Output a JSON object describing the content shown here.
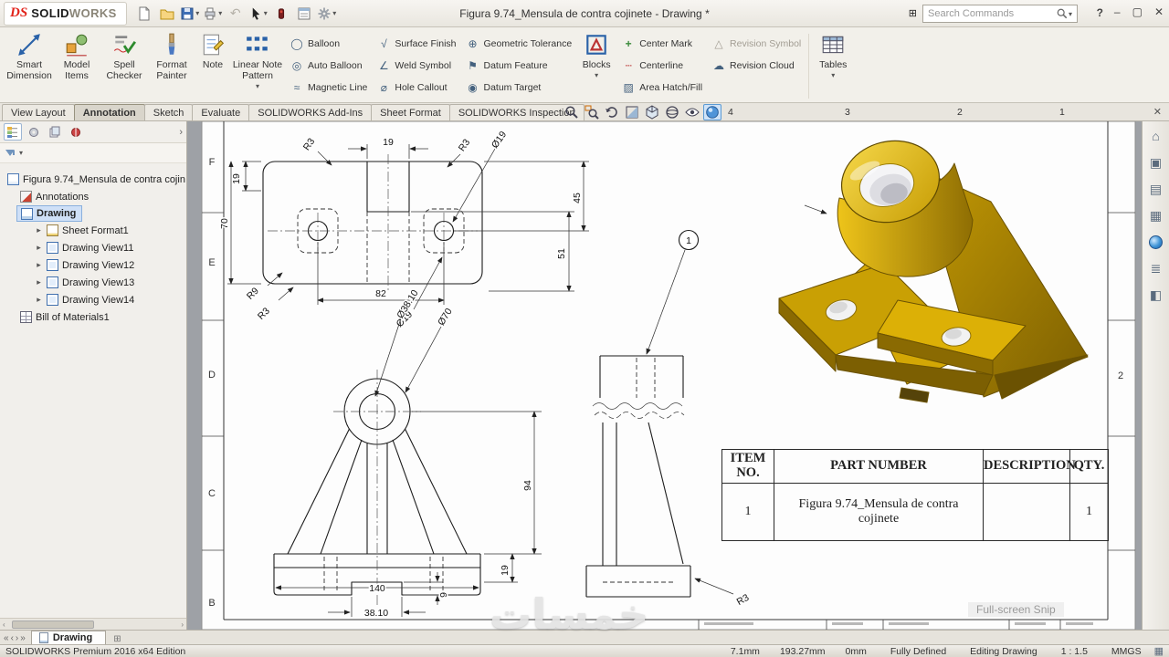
{
  "titlebar": {
    "logo_mark": "DS",
    "brand_solid": "SOLID",
    "brand_works": "WORKS",
    "title": "Figura 9.74_Mensula de contra cojinete - Drawing *",
    "search_placeholder": "Search Commands",
    "help_label": "?",
    "window": {
      "minimize": "–",
      "maximize": "▢",
      "close": "✕"
    }
  },
  "ribbon": {
    "large": [
      {
        "label": "Smart Dimension"
      },
      {
        "label": "Model Items"
      },
      {
        "label": "Spell Checker"
      },
      {
        "label": "Format Painter"
      },
      {
        "label": "Note"
      },
      {
        "label": "Linear Note Pattern"
      },
      {
        "label": "Blocks"
      },
      {
        "label": "Tables"
      }
    ],
    "small": [
      "Balloon",
      "Auto Balloon",
      "Magnetic Line",
      "Surface Finish",
      "Weld Symbol",
      "Hole Callout",
      "Geometric Tolerance",
      "Datum Feature",
      "Datum Target",
      "Center Mark",
      "Centerline",
      "Area Hatch/Fill",
      "Revision Symbol",
      "Revision Cloud"
    ]
  },
  "tabs": {
    "items": [
      "View Layout",
      "Annotation",
      "Sketch",
      "Evaluate",
      "SOLIDWORKS Add-Ins",
      "Sheet Format",
      "SOLIDWORKS Inspection"
    ],
    "active": "Annotation"
  },
  "zones": {
    "top": [
      "4",
      "3",
      "2",
      "1"
    ],
    "left": [
      "F",
      "E",
      "D",
      "C",
      "B"
    ],
    "right_mid": "2"
  },
  "tree": {
    "root": "Figura 9.74_Mensula de contra cojin",
    "items": [
      {
        "label": "Annotations"
      },
      {
        "label": "Drawing"
      },
      {
        "label": "Sheet Format1"
      },
      {
        "label": "Drawing View11"
      },
      {
        "label": "Drawing View12"
      },
      {
        "label": "Drawing View13"
      },
      {
        "label": "Drawing View14"
      },
      {
        "label": "Bill of Materials1"
      }
    ]
  },
  "drawing": {
    "top_view": {
      "dim_19_top": "19",
      "dim_r3_tl": "R3",
      "dim_r3_tr": "R3",
      "dim_dia19_tr": "Ø19",
      "dim_19_left": "19",
      "dim_70": "70",
      "dim_r9": "R9",
      "dim_r3_bl": "R3",
      "dim_82": "82",
      "dim_dia19_bottom": "Ø19",
      "dim_45": "45",
      "dim_51": "51"
    },
    "front_view": {
      "dim_dia3810": "Ø38.10",
      "dim_dia70": "Ø70",
      "dim_94": "94",
      "dim_19": "19",
      "dim_140": "140",
      "dim_3810": "38.10",
      "dim_9": "9"
    },
    "side_view": {
      "balloon": "1",
      "dim_r3": "R3"
    },
    "bom": {
      "headers": [
        "ITEM NO.",
        "PART NUMBER",
        "DESCRIPTION",
        "QTY."
      ],
      "row": {
        "item": "1",
        "part": "Figura 9.74_Mensula de contra cojinete",
        "desc": "",
        "qty": "1"
      }
    }
  },
  "sheet_tab": {
    "label": "Drawing"
  },
  "statusbar": {
    "edition": "SOLIDWORKS Premium 2016 x64 Edition",
    "coord_x": "7.1mm",
    "coord_y": "193.27mm",
    "coord_z": "0mm",
    "defined": "Fully Defined",
    "mode": "Editing Drawing",
    "scale": "1 : 1.5",
    "units": "MMGS"
  },
  "overlay": {
    "snip": "Full-screen Snip",
    "watermark": "خمسات"
  },
  "icons": {
    "balloon": "◯",
    "auto_balloon": "◎",
    "magnetic_line": "≈",
    "surface_finish": "√",
    "weld_symbol": "∠",
    "hole_callout": "⌀",
    "geometric_tolerance": "⊕",
    "datum_feature": "⚑",
    "datum_target": "◉",
    "center_mark": "+",
    "centerline": "┄",
    "area_hatch": "▨",
    "revision_symbol": "△",
    "revision_cloud": "☁",
    "undo": "↶",
    "caret": "▾",
    "expand": "▸",
    "chevron": "›",
    "home": "⌂",
    "library": "▣",
    "explorer": "▤",
    "palette": "▦",
    "props": "≣",
    "forum": "◧",
    "nav_first": "«",
    "nav_prev": "‹",
    "nav_next": "›",
    "nav_last": "»",
    "grid": "▦",
    "search_pane": "⊞"
  }
}
